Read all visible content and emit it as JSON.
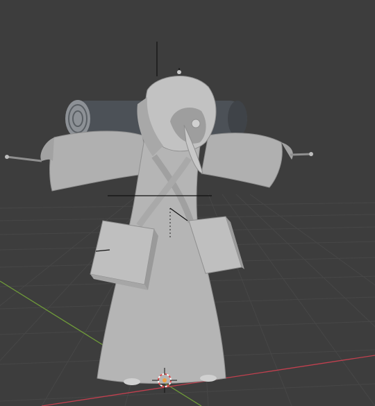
{
  "viewport": {
    "background": "#3d3d3d",
    "grid_color": "#474747",
    "axis_x_color": "#c2404f",
    "axis_y_color": "#6f9b3a",
    "model_color": "#b5b5b5",
    "model_shadow": "#8f8f8f",
    "bedroll_color": "#4c5157",
    "origin_cursor_color": "#e04f4f",
    "selected_bone_color": "#111111"
  },
  "objects": [
    {
      "name": "plague-doctor-model"
    },
    {
      "name": "bedroll"
    },
    {
      "name": "satchel-left"
    },
    {
      "name": "satchel-right"
    },
    {
      "name": "armature-bones"
    },
    {
      "name": "3d-cursor"
    }
  ]
}
